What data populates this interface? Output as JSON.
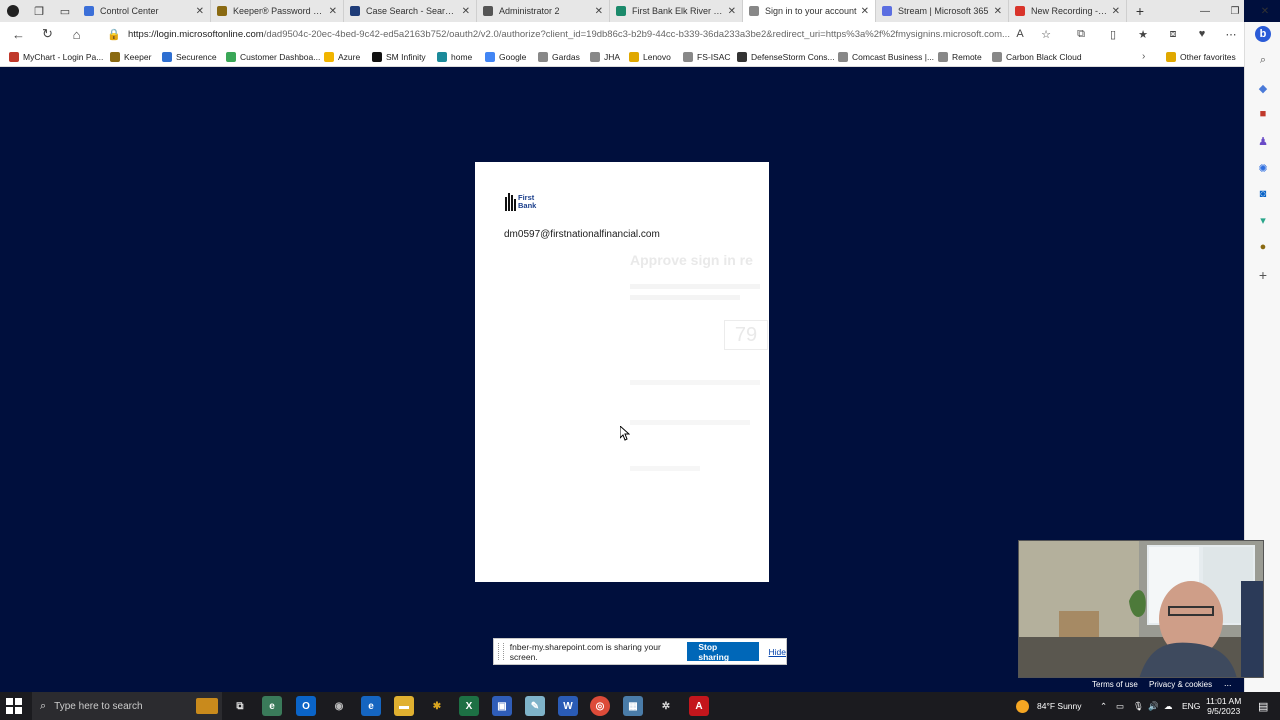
{
  "tabs": [
    {
      "label": "Control Center",
      "color": "#3b6fd8",
      "active": false
    },
    {
      "label": "Keeper® Password Mana",
      "color": "#8a6a12",
      "active": false
    },
    {
      "label": "Case Search - Search for",
      "color": "#1e3c78",
      "active": false
    },
    {
      "label": "Administrator 2",
      "color": "#555555",
      "active": false
    },
    {
      "label": "First Bank Elk River Team",
      "color": "#1b8a6b",
      "active": false
    },
    {
      "label": "Sign in to your account",
      "color": "#888888",
      "active": true
    },
    {
      "label": "Stream | Microsoft 365",
      "color": "#5b6ee1",
      "active": false
    },
    {
      "label": "New Recording - Ca",
      "color": "#d9342b",
      "active": false
    }
  ],
  "addressbar": {
    "host": "https://login.microsoftonline.com",
    "path": "/dad9504c-20ec-4bed-9c42-ed5a2163b752/oauth2/v2.0/authorize?client_id=19db86c3-b2b9-44cc-b339-36da233a3be2&redirect_uri=https%3a%2f%2fmysignins.microsoft.com..."
  },
  "favorites": [
    {
      "label": "MyChart - Login Pa...",
      "color": "#c0392b"
    },
    {
      "label": "Keeper",
      "color": "#8a6a12"
    },
    {
      "label": "Securence",
      "color": "#2e6fd1"
    },
    {
      "label": "Customer Dashboa...",
      "color": "#3aa757"
    },
    {
      "label": "Azure",
      "color": "#f1b500"
    },
    {
      "label": "SM Infinity",
      "color": "#111111"
    },
    {
      "label": "home",
      "color": "#1b8a9a"
    },
    {
      "label": "Google",
      "color": "#4285f4"
    },
    {
      "label": "Gardas",
      "color": "#888888"
    },
    {
      "label": "JHA",
      "color": "#888888"
    },
    {
      "label": "Lenovo",
      "color": "#e0a800"
    },
    {
      "label": "FS-ISAC",
      "color": "#888888"
    },
    {
      "label": "DefenseStorm Cons...",
      "color": "#333333"
    },
    {
      "label": "Comcast Business |...",
      "color": "#888888"
    },
    {
      "label": "Remote",
      "color": "#888888"
    },
    {
      "label": "Carbon Black Cloud",
      "color": "#888888"
    },
    {
      "label": "Other favorites",
      "color": "#e0a800"
    }
  ],
  "signin": {
    "logo_line1": "First",
    "logo_line2": "Bank",
    "email": "dm0597@firstnationalfinancial.com",
    "faded_heading": "Approve sign in re",
    "faded_number": "79"
  },
  "sharebar": {
    "message": "fnber-my.sharepoint.com is sharing your screen.",
    "stop_label": "Stop sharing",
    "hide_label": "Hide"
  },
  "footer": {
    "terms": "Terms of use",
    "privacy": "Privacy & cookies",
    "more": "..."
  },
  "taskbar": {
    "search_placeholder": "Type here to search",
    "weather": "84°F  Sunny",
    "language": "ENG",
    "time": "11:01 AM",
    "date": "9/5/2023"
  },
  "colors": {
    "page_background": "#000f3d",
    "accent": "#0067b8"
  }
}
